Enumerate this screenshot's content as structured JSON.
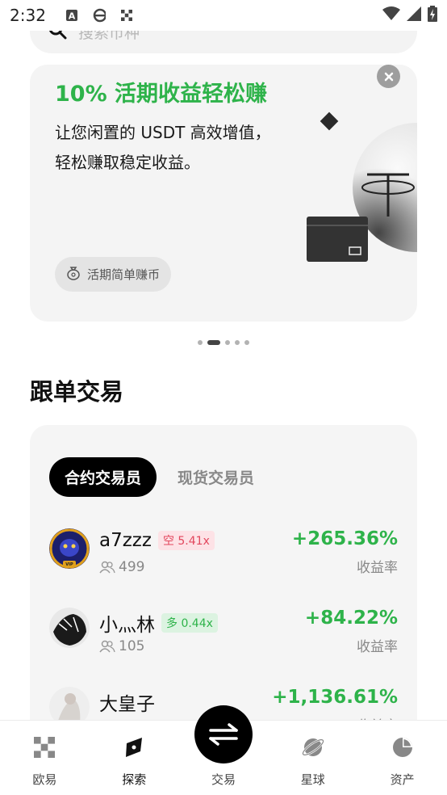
{
  "statusbar": {
    "time": "2:32"
  },
  "search": {
    "placeholder": "搜索币种"
  },
  "promo": {
    "title": "10% 活期收益轻松赚",
    "desc_line1": "让您闲置的 USDT 高效增值，",
    "desc_line2": "轻松赚取稳定收益。",
    "chip_label": "活期简单赚币"
  },
  "carousel": {
    "count": 5,
    "active_index": 1
  },
  "copy_trading": {
    "title": "跟单交易",
    "tabs": [
      {
        "label": "合约交易员",
        "active": true
      },
      {
        "label": "现货交易员",
        "active": false
      }
    ],
    "traders": [
      {
        "name": "a7zzz",
        "tag": "空 5.41x",
        "tag_type": "short",
        "followers": "499",
        "yield": "+265.36%",
        "yield_label": "收益率"
      },
      {
        "name": "小灬林",
        "tag": "多 0.44x",
        "tag_type": "long",
        "followers": "105",
        "yield": "+84.22%",
        "yield_label": "收益率"
      },
      {
        "name": "大皇子",
        "tag": "",
        "tag_type": "",
        "followers": "",
        "yield": "+1,136.61%",
        "yield_label": "收益率"
      }
    ]
  },
  "colors": {
    "green": "#2eb34a",
    "red": "#e2475d",
    "accent": "#000000"
  },
  "bottom_nav": [
    {
      "label": "欧易",
      "icon": "okx-logo-icon"
    },
    {
      "label": "探索",
      "icon": "compass-icon",
      "active": true
    },
    {
      "label": "交易",
      "icon": "swap-icon"
    },
    {
      "label": "星球",
      "icon": "planet-icon"
    },
    {
      "label": "资产",
      "icon": "pie-chart-icon"
    }
  ]
}
